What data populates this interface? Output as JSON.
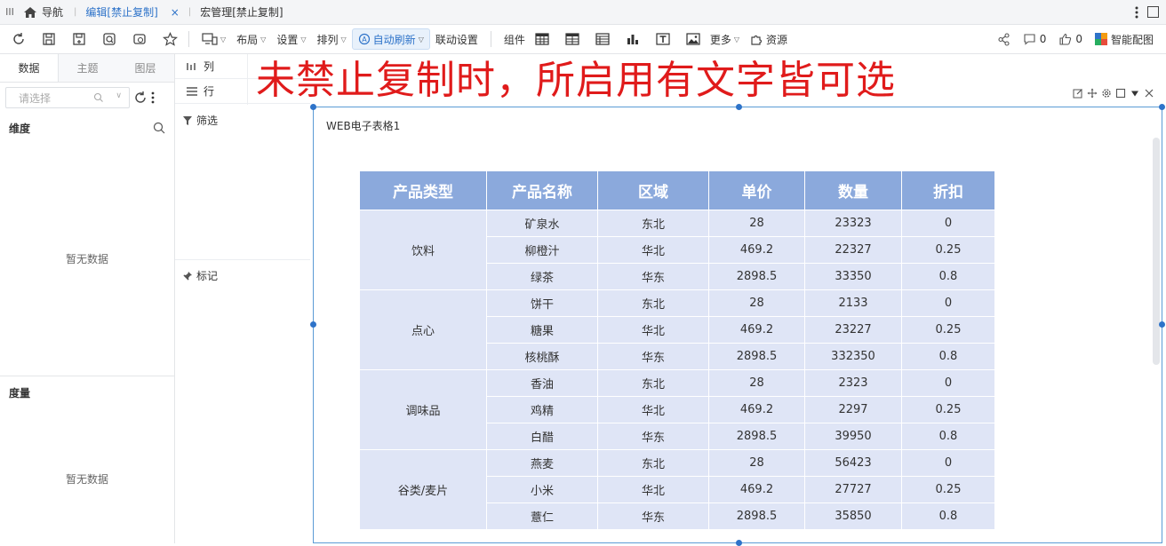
{
  "topbar": {
    "menu_glyph": "III",
    "home_label": "导航",
    "tabs": [
      {
        "label": "编辑[禁止复制]",
        "close": "×"
      },
      {
        "label": "宏管理[禁止复制]"
      }
    ]
  },
  "toolbar": {
    "layout": "布局",
    "settings": "设置",
    "arrange": "排列",
    "auto_refresh": "自动刷新",
    "linkage": "联动设置",
    "components": "组件",
    "more": "更多",
    "resources": "资源",
    "comment_count": "0",
    "like_count": "0",
    "smart_chart": "智能配图"
  },
  "left_panel": {
    "tabs": [
      "数据",
      "主题",
      "图层"
    ],
    "select_placeholder": "请选择",
    "dimension_title": "维度",
    "dimension_empty": "暂无数据",
    "measure_title": "度量",
    "measure_empty": "暂无数据"
  },
  "mid_panel": {
    "columns_label": "列",
    "rows_label": "行",
    "filter_label": "筛选",
    "mark_label": "标记"
  },
  "headline": "未禁止复制时，所启用有文字皆可选",
  "widget": {
    "title": "WEB电子表格1"
  },
  "table": {
    "headers": [
      "产品类型",
      "产品名称",
      "区域",
      "单价",
      "数量",
      "折扣"
    ],
    "groups": [
      {
        "type": "饮料",
        "rows": [
          [
            "矿泉水",
            "东北",
            "28",
            "23323",
            "0"
          ],
          [
            "柳橙汁",
            "华北",
            "469.2",
            "22327",
            "0.25"
          ],
          [
            "绿茶",
            "华东",
            "2898.5",
            "33350",
            "0.8"
          ]
        ]
      },
      {
        "type": "点心",
        "rows": [
          [
            "饼干",
            "东北",
            "28",
            "2133",
            "0"
          ],
          [
            "糖果",
            "华北",
            "469.2",
            "23227",
            "0.25"
          ],
          [
            "核桃酥",
            "华东",
            "2898.5",
            "332350",
            "0.8"
          ]
        ]
      },
      {
        "type": "调味品",
        "rows": [
          [
            "香油",
            "东北",
            "28",
            "2323",
            "0"
          ],
          [
            "鸡精",
            "华北",
            "469.2",
            "2297",
            "0.25"
          ],
          [
            "白醋",
            "华东",
            "2898.5",
            "39950",
            "0.8"
          ]
        ]
      },
      {
        "type": "谷类/麦片",
        "rows": [
          [
            "燕麦",
            "东北",
            "28",
            "56423",
            "0"
          ],
          [
            "小米",
            "华北",
            "469.2",
            "27727",
            "0.25"
          ],
          [
            "薏仁",
            "华东",
            "2898.5",
            "35850",
            "0.8"
          ]
        ]
      }
    ]
  },
  "colors": {
    "accent": "#2e73c9",
    "headline": "#e01b1b",
    "table_header": "#8ba9dc",
    "table_cell": "#dfe5f6"
  }
}
